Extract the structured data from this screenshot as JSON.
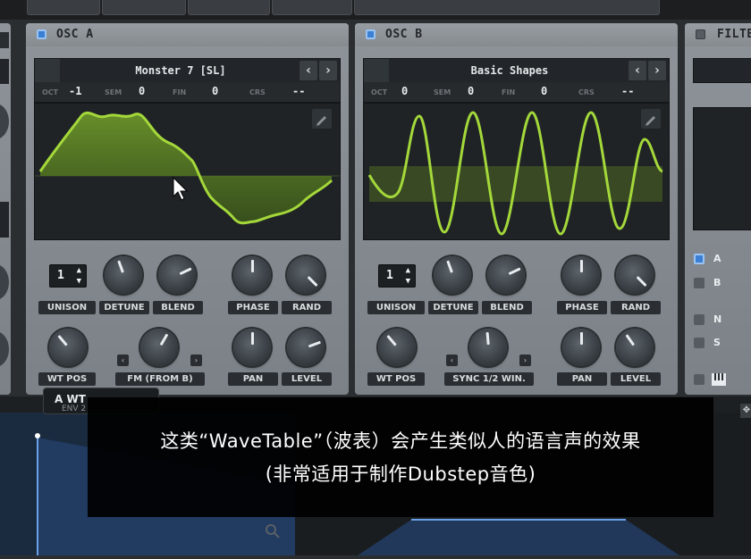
{
  "osc_a": {
    "title": "OSC A",
    "wavetable": "Monster 7 [SL]",
    "oct_label": "OCT",
    "oct_value": "-1",
    "sem_label": "SEM",
    "sem_value": "0",
    "fin_label": "FIN",
    "fin_value": "0",
    "crs_label": "CRS",
    "crs_value": "--",
    "unison_value": "1",
    "knob_labels": [
      "UNISON",
      "DETUNE",
      "BLEND",
      "PHASE",
      "RAND"
    ],
    "knob_labels2": [
      "WT POS",
      "FM (FROM B)",
      "PAN",
      "LEVEL"
    ]
  },
  "osc_b": {
    "title": "OSC B",
    "wavetable": "Basic Shapes",
    "oct_label": "OCT",
    "oct_value": "0",
    "sem_label": "SEM",
    "sem_value": "0",
    "fin_label": "FIN",
    "fin_value": "0",
    "crs_label": "CRS",
    "crs_value": "--",
    "unison_value": "1",
    "knob_labels": [
      "UNISON",
      "DETUNE",
      "BLEND",
      "PHASE",
      "RAND"
    ],
    "knob_labels2": [
      "WT POS",
      "SYNC 1/2 WIN.",
      "PAN",
      "LEVEL"
    ]
  },
  "filter": {
    "title": "FILTER",
    "routes": [
      "A",
      "B",
      "N",
      "S"
    ]
  },
  "bottom": {
    "tab_label": "A WT",
    "env_label": "ENV 2"
  },
  "subtitle": {
    "line1": "这类“WaveTable”（波表）会产生类似人的语言声的效果",
    "line2": "(非常适用于制作Dubstep音色)"
  },
  "colors": {
    "wave": "#9fd631",
    "accent": "#3b7fd4"
  },
  "icons": {
    "edit": "pencil-icon",
    "prev": "chevron-left-icon",
    "next": "chevron-right-icon",
    "keys": "piano-keys-icon"
  }
}
